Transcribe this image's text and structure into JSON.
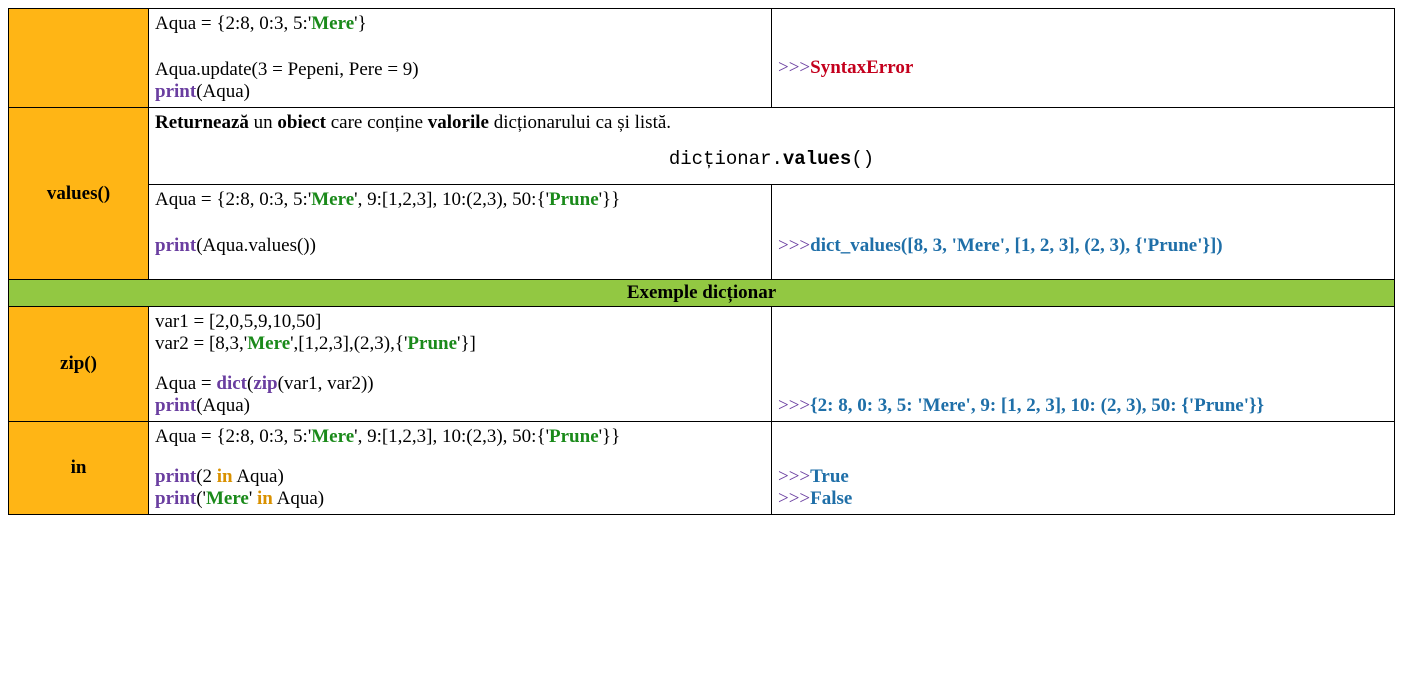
{
  "row_update": {
    "code": {
      "line1_pre": "Aqua = {2:8, 0:3, 5:'",
      "line1_str": "Mere",
      "line1_post": "'}",
      "line3_pre": "Aqua.update(3 = Pepeni, Pere = 9)",
      "line4_kw": "print",
      "line4_post": "(Aqua)"
    },
    "output": {
      "prompt": ">>>",
      "err": "SyntaxError"
    }
  },
  "row_values": {
    "name": "values()",
    "desc": {
      "p1": "Returnează",
      "p2": " un ",
      "p3": "obiect",
      "p4": " care conține ",
      "p5": "valorile",
      "p6": " dicționarului ca și listă."
    },
    "syntax_pre": "dicționar.",
    "syntax_bold": "values",
    "syntax_post": "()",
    "code": {
      "line1_a": "Aqua = {2:8, 0:3, 5:'",
      "line1_s1": "Mere",
      "line1_b": "', 9:[1,2,3], 10:(2,3), 50:{'",
      "line1_s2": "Prune",
      "line1_c": "'}}",
      "line3_kw": "print",
      "line3_post": "(Aqua.values())"
    },
    "output": {
      "prompt": ">>>",
      "val": "dict_values([8, 3, 'Mere', [1, 2, 3], (2, 3), {'Prune'}])"
    }
  },
  "section_header": "Exemple dicționar",
  "row_zip": {
    "name": "zip()",
    "code": {
      "l1": "var1 = [2,0,5,9,10,50]",
      "l2_a": "var2 = [8,3,'",
      "l2_s1": "Mere",
      "l2_b": "',[1,2,3],(2,3),{'",
      "l2_s2": "Prune",
      "l2_c": "'}]",
      "l4_a": "Aqua = ",
      "l4_kw1": "dict",
      "l4_b": "(",
      "l4_kw2": "zip",
      "l4_c": "(var1, var2))",
      "l5_kw": "print",
      "l5_post": "(Aqua)"
    },
    "output": {
      "prompt": ">>>",
      "val": "{2: 8, 0: 3, 5: 'Mere', 9: [1, 2, 3], 10: (2, 3), 50: {'Prune'}}"
    }
  },
  "row_in": {
    "name": "in",
    "code": {
      "l1_a": "Aqua = {2:8, 0:3, 5:'",
      "l1_s1": "Mere",
      "l1_b": "', 9:[1,2,3], 10:(2,3), 50:{'",
      "l1_s2": "Prune",
      "l1_c": "'}}",
      "l3_kw": "print",
      "l3_a": "(2 ",
      "l3_in": "in",
      "l3_b": " Aqua)",
      "l4_kw": "print",
      "l4_a": "('",
      "l4_s": "Mere",
      "l4_b": "' ",
      "l4_in": "in",
      "l4_c": " Aqua)"
    },
    "output": {
      "prompt": ">>>",
      "val1": "True",
      "val2": "False"
    }
  }
}
